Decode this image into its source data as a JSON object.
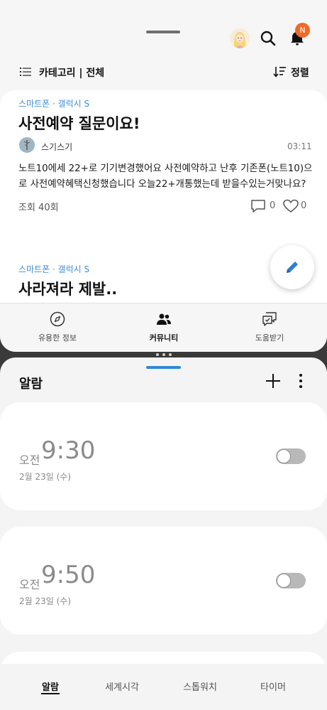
{
  "community": {
    "header": {
      "notification_count": "N",
      "category_label": "카테고리 | 전체",
      "sort_label": "정렬"
    },
    "posts": [
      {
        "tag": "스마트폰 · 갤럭시 S",
        "title": "사전예약 질문이요!",
        "author": "스기스기",
        "time": "03:11",
        "body": "노트10에세 22+로 기기변경했어요 사전예약하고 난후 기존폰(노트10)으로 사전예약혜택신청했습니다 오늘22+개통했는데 받을수있는거맞나요?",
        "views": "조회 40회",
        "comments": "0",
        "likes": "0"
      },
      {
        "tag": "스마트폰 · 갤럭시 S",
        "title": "사라져라 제발.."
      }
    ],
    "nav": [
      {
        "label": "유용한 정보",
        "icon": "compass-icon",
        "active": false
      },
      {
        "label": "커뮤니티",
        "icon": "people-icon",
        "active": true
      },
      {
        "label": "도움받기",
        "icon": "help-chat-icon",
        "active": false
      }
    ]
  },
  "clock": {
    "title": "알람",
    "alarms": [
      {
        "ampm": "오전",
        "time": "9:30",
        "date": "2월 23일 (수)",
        "enabled": false
      },
      {
        "ampm": "오전",
        "time": "9:50",
        "date": "2월 23일 (수)",
        "enabled": false
      }
    ],
    "tabs": [
      {
        "label": "알람",
        "active": true
      },
      {
        "label": "세계시각",
        "active": false
      },
      {
        "label": "스톱워치",
        "active": false
      },
      {
        "label": "타이머",
        "active": false
      }
    ]
  },
  "colors": {
    "accent_blue": "#3f8dd6",
    "badge_orange": "#ef6a2a",
    "handle_blue": "#2f88d8"
  }
}
